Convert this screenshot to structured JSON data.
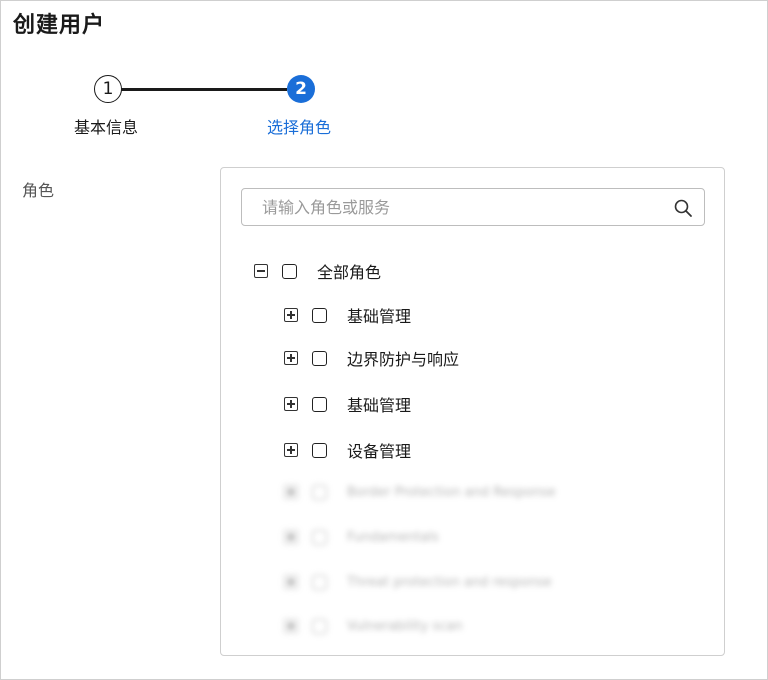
{
  "page": {
    "title": "创建用户"
  },
  "stepper": {
    "steps": [
      {
        "number": "1",
        "label": "基本信息",
        "state": "completed"
      },
      {
        "number": "2",
        "label": "选择角色",
        "state": "active"
      }
    ]
  },
  "form": {
    "field_label": "角色"
  },
  "search": {
    "placeholder": "请输入角色或服务",
    "value": "",
    "icon": "search-icon"
  },
  "tree": {
    "root": {
      "label": "全部角色",
      "expanded": true,
      "checked": false
    },
    "children": [
      {
        "label": "基础管理",
        "expanded": false,
        "checked": false
      },
      {
        "label": "边界防护与响应",
        "expanded": false,
        "checked": false
      },
      {
        "label": "基础管理",
        "expanded": false,
        "checked": false
      },
      {
        "label": "设备管理",
        "expanded": false,
        "checked": false
      },
      {
        "label": "Border Protection and Response",
        "expanded": false,
        "checked": false,
        "blurred": true
      },
      {
        "label": "Fundamentals",
        "expanded": false,
        "checked": false,
        "blurred": true
      },
      {
        "label": "Threat protection and response",
        "expanded": false,
        "checked": false,
        "blurred": true
      },
      {
        "label": "Vulnerability scan",
        "expanded": false,
        "checked": false,
        "blurred": true
      }
    ]
  },
  "colors": {
    "accent": "#1a6ed8",
    "text": "#1a1a1a",
    "border": "#cfcfcf"
  }
}
